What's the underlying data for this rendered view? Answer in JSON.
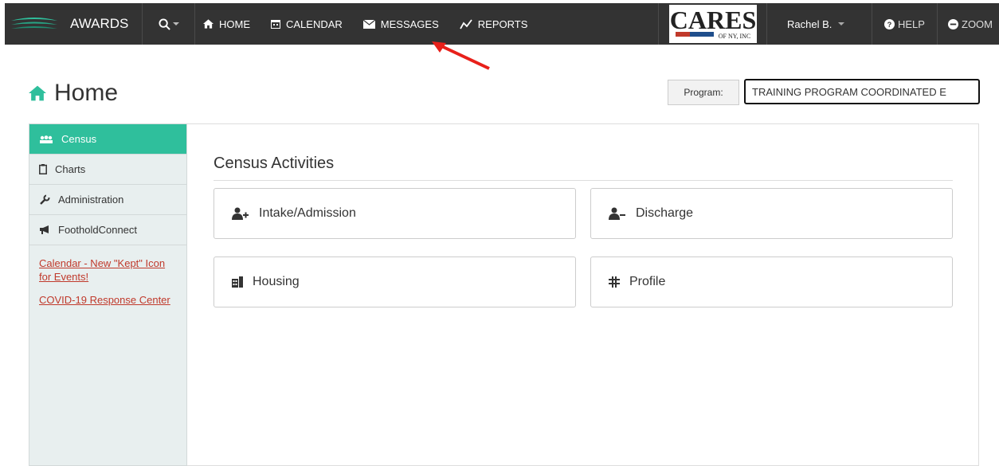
{
  "app": {
    "brand_name": "AWARDS",
    "org_logo_text": "CARES",
    "org_logo_subtext": "OF NY, INC"
  },
  "nav": {
    "items": [
      {
        "label": "HOME",
        "icon": "home-icon"
      },
      {
        "label": "CALENDAR",
        "icon": "calendar-icon"
      },
      {
        "label": "MESSAGES",
        "icon": "envelope-icon"
      },
      {
        "label": "REPORTS",
        "icon": "line-chart-icon"
      }
    ],
    "user": "Rachel B.",
    "help": "HELP",
    "zoom": "ZOOM"
  },
  "page": {
    "title": "Home",
    "program_label": "Program:",
    "program_value": "TRAINING PROGRAM COORDINATED E"
  },
  "sidebar": {
    "items": [
      {
        "label": "Census",
        "icon": "users-icon",
        "active": true
      },
      {
        "label": "Charts",
        "icon": "clipboard-icon",
        "active": false
      },
      {
        "label": "Administration",
        "icon": "wrench-icon",
        "active": false
      },
      {
        "label": "FootholdConnect",
        "icon": "megaphone-icon",
        "active": false
      }
    ],
    "links": [
      "Calendar - New \"Kept\" Icon for Events!",
      "COVID-19 Response Center"
    ]
  },
  "main": {
    "section_title": "Census Activities",
    "tiles": [
      {
        "label": "Intake/Admission",
        "icon": "user-plus-icon"
      },
      {
        "label": "Discharge",
        "icon": "user-minus-icon"
      },
      {
        "label": "Housing",
        "icon": "building-icon"
      },
      {
        "label": "Profile",
        "icon": "profile-icon"
      }
    ]
  },
  "colors": {
    "topbar": "#333333",
    "accent_teal": "#2fbf9c",
    "link_red": "#c0392b",
    "annotation_red": "#e8201a"
  }
}
